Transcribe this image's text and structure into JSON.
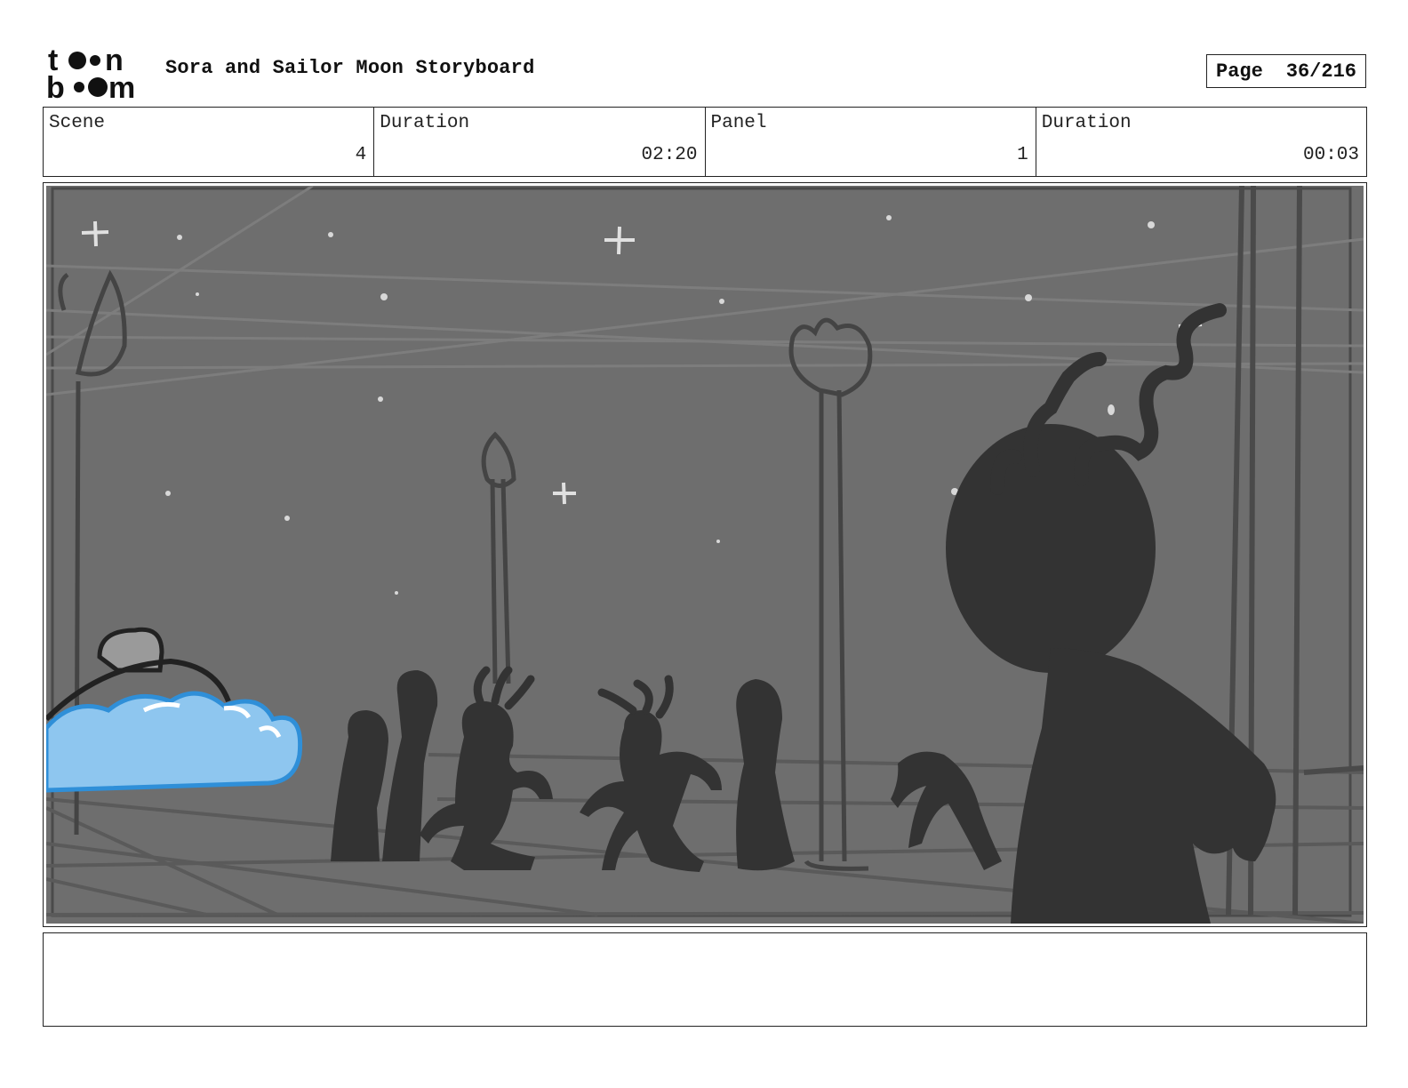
{
  "header": {
    "logo_text_top": "toon",
    "logo_text_bottom": "boom",
    "title": "Sora and Sailor Moon Storyboard",
    "page_label": "Page",
    "page_value": "36/216"
  },
  "info": {
    "scene_label": "Scene",
    "scene_value": "4",
    "scene_duration_label": "Duration",
    "scene_duration_value": "02:20",
    "panel_label": "Panel",
    "panel_value": "1",
    "panel_duration_label": "Duration",
    "panel_duration_value": "00:03"
  },
  "colors": {
    "sky": "#6e6e6e",
    "silhouette": "#333333",
    "cloud": "#8ec6ef",
    "cloud_outline": "#2f8fd8",
    "line": "#555555"
  },
  "notes": {
    "text": ""
  }
}
